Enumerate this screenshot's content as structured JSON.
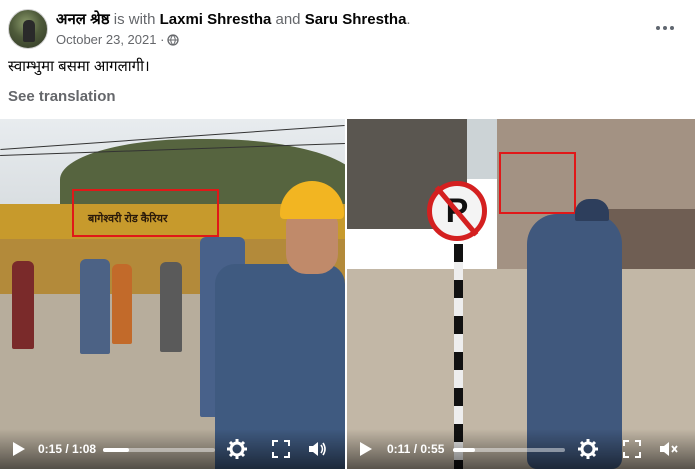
{
  "post": {
    "author": "अनल श्रेष्ठ",
    "with_text": "is with",
    "tagged_1": "Laxmi Shrestha",
    "and_text": "and",
    "tagged_2": "Saru Shrestha",
    "period": ".",
    "date": "October 23, 2021 ·",
    "text": "स्वाम्भुमा बसमा आगलागी।",
    "see_translation": "See translation"
  },
  "videos": [
    {
      "sign_text": "बागेश्वरी रोड कैरियर",
      "time": "0:15 / 1:08",
      "progress": 0.23
    },
    {
      "sign_text": "",
      "time": "0:11 / 0:55",
      "progress": 0.2
    }
  ],
  "icons": [
    "globe-icon",
    "more-icon",
    "play-icon",
    "settings-icon",
    "fullscreen-icon",
    "volume-icon"
  ],
  "colors": {
    "highlight_box": "#e01818",
    "muted_text": "#65676b",
    "control_text": "#ffffff"
  }
}
